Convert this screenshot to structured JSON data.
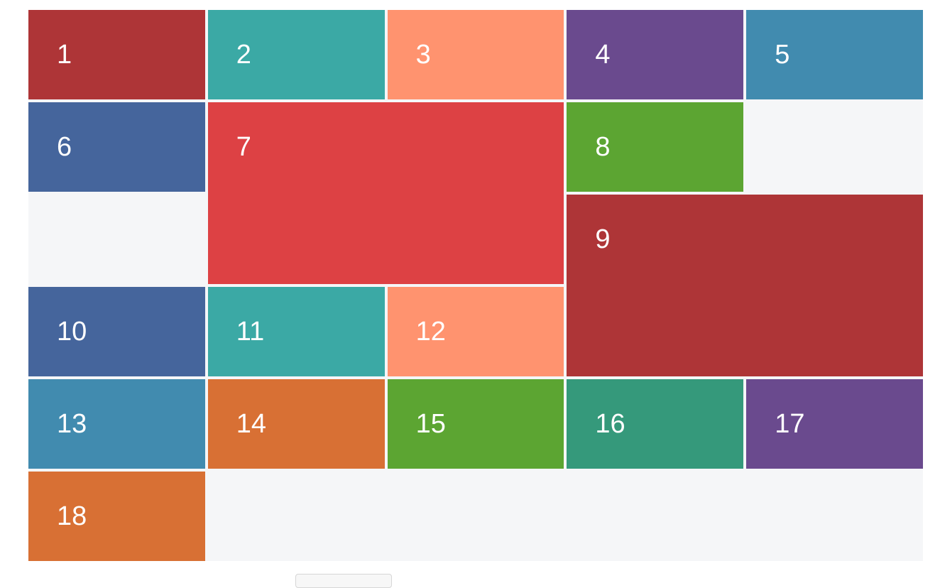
{
  "grid": {
    "items": [
      {
        "label": "1",
        "color": "#ae3537"
      },
      {
        "label": "2",
        "color": "#3ba9a5"
      },
      {
        "label": "3",
        "color": "#ff936f"
      },
      {
        "label": "4",
        "color": "#6a4a8e"
      },
      {
        "label": "5",
        "color": "#418baf"
      },
      {
        "label": "6",
        "color": "#45659c"
      },
      {
        "label": "7",
        "color": "#dd4144"
      },
      {
        "label": "8",
        "color": "#5ca532"
      },
      {
        "label": "9",
        "color": "#ae3537"
      },
      {
        "label": "10",
        "color": "#45659c"
      },
      {
        "label": "11",
        "color": "#3ba9a5"
      },
      {
        "label": "12",
        "color": "#ff936f"
      },
      {
        "label": "13",
        "color": "#418baf"
      },
      {
        "label": "14",
        "color": "#d87034"
      },
      {
        "label": "15",
        "color": "#5ca532"
      },
      {
        "label": "16",
        "color": "#35997b"
      },
      {
        "label": "17",
        "color": "#6a4a8e"
      },
      {
        "label": "18",
        "color": "#d87034"
      }
    ]
  },
  "button": {
    "label": ""
  }
}
